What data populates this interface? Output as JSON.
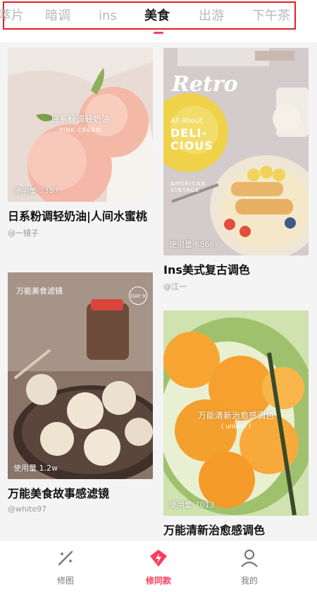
{
  "tabs": [
    {
      "label": "萃片",
      "active": false
    },
    {
      "label": "暗调",
      "active": false
    },
    {
      "label": "ins",
      "active": false
    },
    {
      "label": "美食",
      "active": true
    },
    {
      "label": "出游",
      "active": false
    },
    {
      "label": "下午茶",
      "active": false
    }
  ],
  "cards": [
    {
      "title": "日系粉调轻奶油|人间水蜜桃",
      "author": "@一镜子",
      "usage": "使用量 7387",
      "overlay_title": "日系粉调轻奶油",
      "overlay_sub": "PINK CREAM"
    },
    {
      "title": "Ins美式复古调色",
      "author": "@江一",
      "usage": "使用量 6866",
      "overlay_title": "Retro",
      "overlay_sub": "All About",
      "overlay_big": "DELI-CIOUS",
      "overlay_small": "AMERICAN VINTAGE"
    },
    {
      "title": "万能美食故事感滤镜",
      "author": "@white97",
      "usage": "使用量 1.2w",
      "overlay_title": "万能美食滤镜",
      "overlay_day": "DAY 9"
    },
    {
      "title": "万能清新治愈感调色",
      "author": "",
      "usage": "使用量 7013",
      "overlay_title": "万能清新治愈感调色",
      "overlay_sub": "( unlock )"
    }
  ],
  "nav": [
    {
      "label": "修图",
      "icon": "magic-wand-icon",
      "active": false
    },
    {
      "label": "修同款",
      "icon": "lightning-diamond-icon",
      "active": true
    },
    {
      "label": "我的",
      "icon": "person-icon",
      "active": false
    }
  ],
  "colors": {
    "accent": "#ff3b5c",
    "highlight_frame": "#e0202c"
  }
}
